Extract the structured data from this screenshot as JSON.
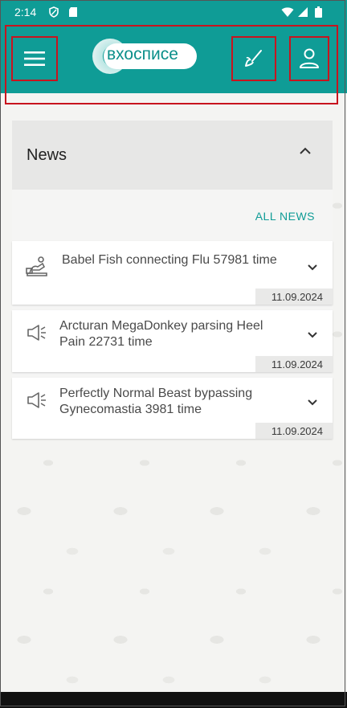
{
  "status_bar": {
    "time": "2:14"
  },
  "app_bar": {
    "logo_text": "вхосписе"
  },
  "news": {
    "title": "News",
    "all_news_label": "ALL NEWS",
    "items": [
      {
        "text": "Babel Fish connecting Flu 57981 time",
        "date": "11.09.2024",
        "icon": "patient-bed-icon"
      },
      {
        "text": "Arcturan MegaDonkey parsing Heel Pain 22731 time",
        "date": "11.09.2024",
        "icon": "megaphone-icon"
      },
      {
        "text": "Perfectly Normal Beast bypassing Gynecomastia 3981 time",
        "date": "11.09.2024",
        "icon": "megaphone-icon"
      }
    ]
  },
  "colors": {
    "accent": "#0f9c96",
    "highlight": "#c8141e"
  }
}
